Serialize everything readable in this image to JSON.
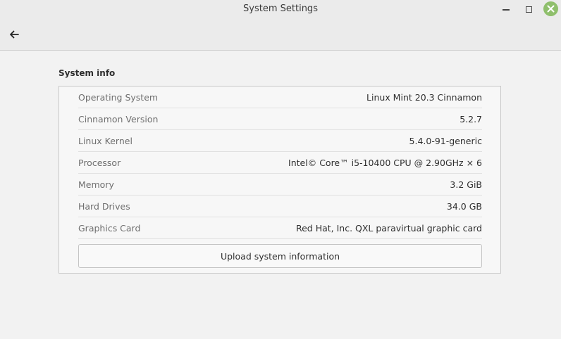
{
  "window": {
    "title": "System Settings"
  },
  "section": {
    "title": "System info"
  },
  "info_rows": [
    {
      "label": "Operating System",
      "value": "Linux Mint 20.3 Cinnamon"
    },
    {
      "label": "Cinnamon Version",
      "value": "5.2.7"
    },
    {
      "label": "Linux Kernel",
      "value": "5.4.0-91-generic"
    },
    {
      "label": "Processor",
      "value": "Intel© Core™ i5-10400 CPU @ 2.90GHz × 6"
    },
    {
      "label": "Memory",
      "value": "3.2 GiB"
    },
    {
      "label": "Hard Drives",
      "value": "34.0 GB"
    },
    {
      "label": "Graphics Card",
      "value": "Red Hat, Inc. QXL paravirtual graphic card"
    }
  ],
  "actions": {
    "upload_label": "Upload system information"
  },
  "icons": {
    "back": "arrow-left-icon",
    "minimize": "minimize-icon",
    "maximize": "maximize-icon",
    "close": "close-icon"
  },
  "colors": {
    "close_button": "#8fbf6c",
    "header_bg": "#ebebeb",
    "content_bg": "#f2f2f2"
  }
}
